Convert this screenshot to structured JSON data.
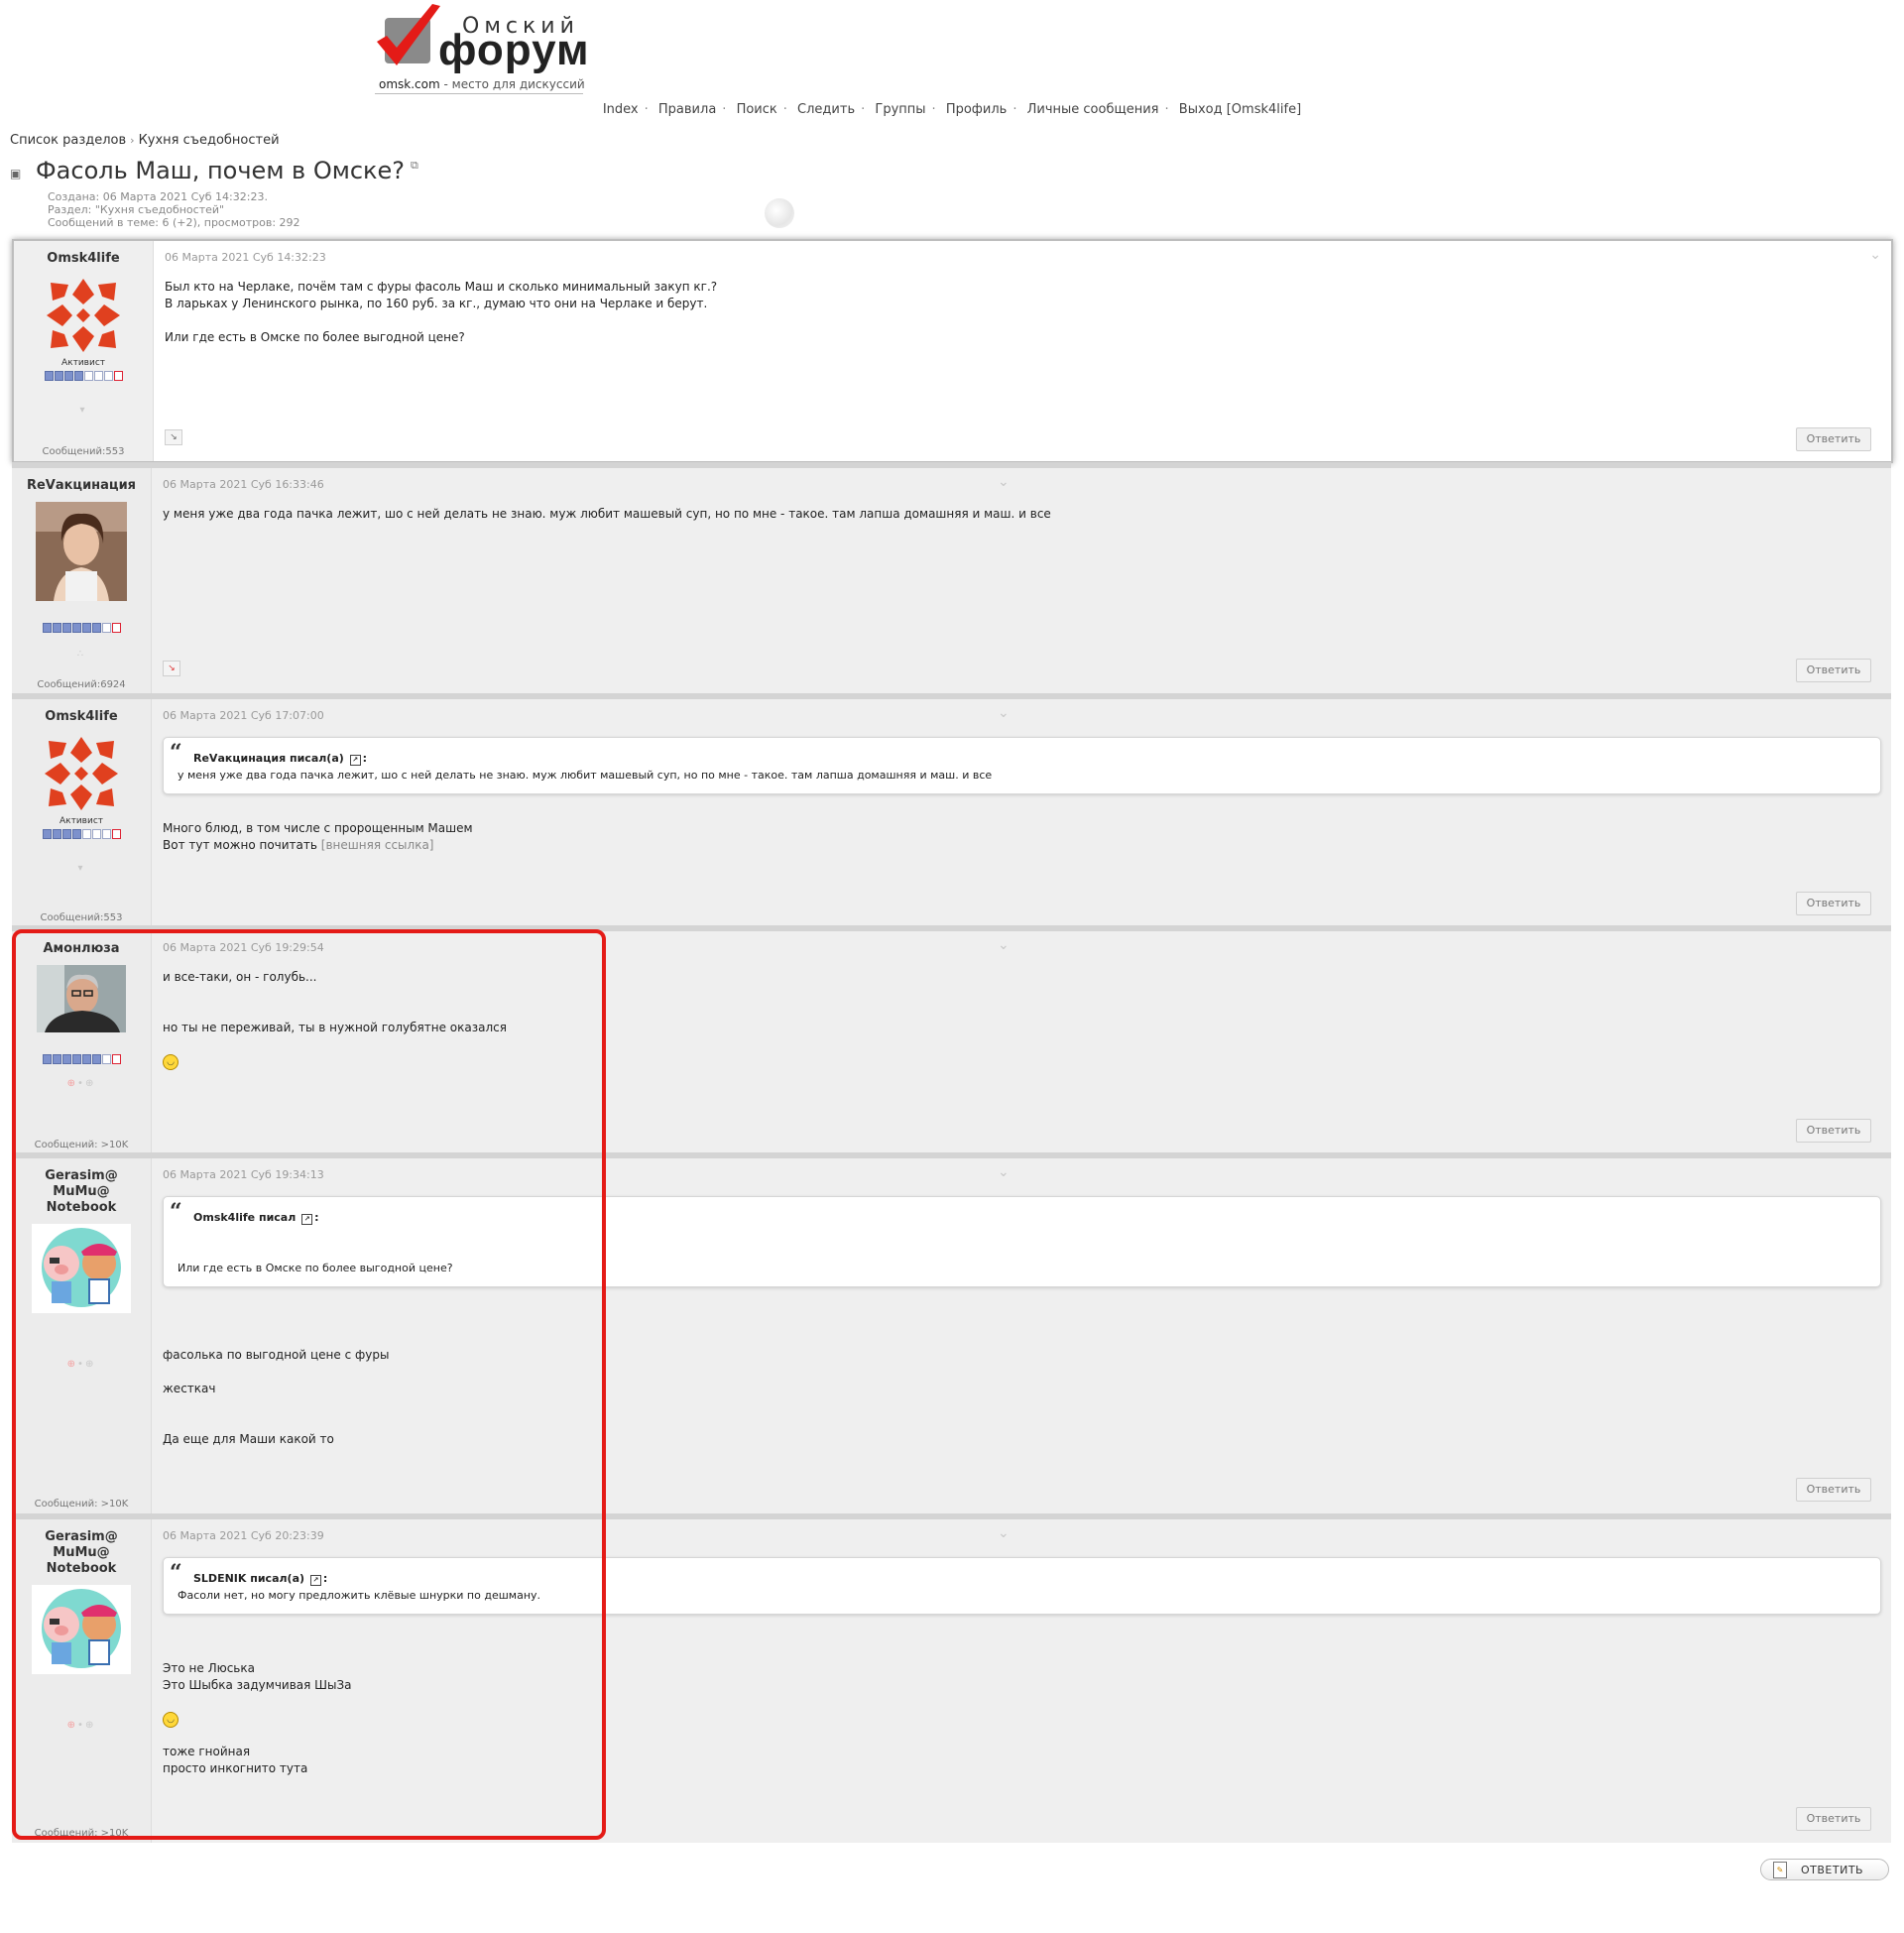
{
  "header": {
    "logo_top": "Омский",
    "logo_main": "форум",
    "logo_domain": "omsk.com",
    "logo_tagline": "- место для дискуссий"
  },
  "nav": [
    {
      "label": "Index"
    },
    {
      "label": "Правила"
    },
    {
      "label": "Поиск"
    },
    {
      "label": "Следить"
    },
    {
      "label": "Группы"
    },
    {
      "label": "Профиль"
    },
    {
      "label": "Личные сообщения"
    },
    {
      "label": "Выход [Omsk4life]"
    }
  ],
  "breadcrumb": {
    "root": "Список разделов",
    "section": "Кухня съедобностей"
  },
  "topic": {
    "title": "Фасоль Маш, почем в Омске?",
    "created": "Создана: 06 Марта 2021 Суб 14:32:23.",
    "section": "Раздел: \"Кухня съедобностей\"",
    "stats": "Сообщений в теме: 6 (+2), просмотров: 292"
  },
  "reply_label": "Ответить",
  "bottom_reply_label": "ОТВЕТИТЬ",
  "posts": [
    {
      "author": "Omsk4life",
      "rank": "Активист",
      "count": "Сообщений:553",
      "date": "06 Марта 2021 Суб 14:32:23",
      "lines": [
        "Был кто на Черлаке, почём там с фуры фасоль Маш и сколько минимальный закуп кг.?",
        "В ларьках у Ленинского рынка, по 160 руб. за кг., думаю что они на Черлаке и берут.",
        "Или где есть в Омске по более выгодной цене?"
      ]
    },
    {
      "author": "ReVакцинация",
      "count": "Сообщений:6924",
      "date": "06 Марта 2021 Суб 16:33:46",
      "lines": [
        "у меня уже два года пачка лежит, шо с ней делать не знаю. муж любит машевый суп, но по мне - такое. там лапша домашняя и маш. и все"
      ]
    },
    {
      "author": "Omsk4life",
      "rank": "Активист",
      "count": "Сообщений:553",
      "date": "06 Марта 2021 Суб 17:07:00",
      "quote_author": "ReVакцинация",
      "quote_wrote": "писал(а)",
      "quote_text": "у меня уже два года пачка лежит, шо с ней делать не знаю. муж любит машевый суп, но по мне - такое. там лапша домашняя и маш. и все",
      "lines": [
        "Много блюд, в том числе с пророщенным Машем",
        "Вот тут можно почитать"
      ],
      "link_text": "[внешняя ссылка]"
    },
    {
      "author": "Амонлюза",
      "count": "Сообщений: >10K",
      "date": "06 Марта 2021 Суб 19:29:54",
      "lines": [
        "и все-таки, он - голубь...",
        "но ты не переживай, ты в нужной голубятне оказался"
      ]
    },
    {
      "author": "Gerasim@ MuMu@ Notebook",
      "count": "Сообщений: >10K",
      "date": "06 Марта 2021 Суб 19:34:13",
      "quote_author": "Omsk4life",
      "quote_wrote": "писал",
      "quote_text": "Или где есть в Омске по более выгодной цене?",
      "lines": [
        "фасолька по выгодной цене с фуры",
        "жесткач",
        "Да еще для Маши какой то"
      ]
    },
    {
      "author": "Gerasim@ MuMu@ Notebook",
      "count": "Сообщений: >10K",
      "date": "06 Марта 2021 Суб 20:23:39",
      "quote_author": "SLDENIK",
      "quote_wrote": "писал(а)",
      "quote_text": "Фасоли нет, но могу предложить клёвые шнурки по дешману.",
      "lines": [
        "Это не Люська",
        "Это Шыбка задумчивая ШыЗа",
        "тоже гнойная",
        "просто инкогнито тута"
      ]
    }
  ],
  "colors": {
    "highlight": "#e41b17",
    "logo_check": "#e41b17"
  }
}
